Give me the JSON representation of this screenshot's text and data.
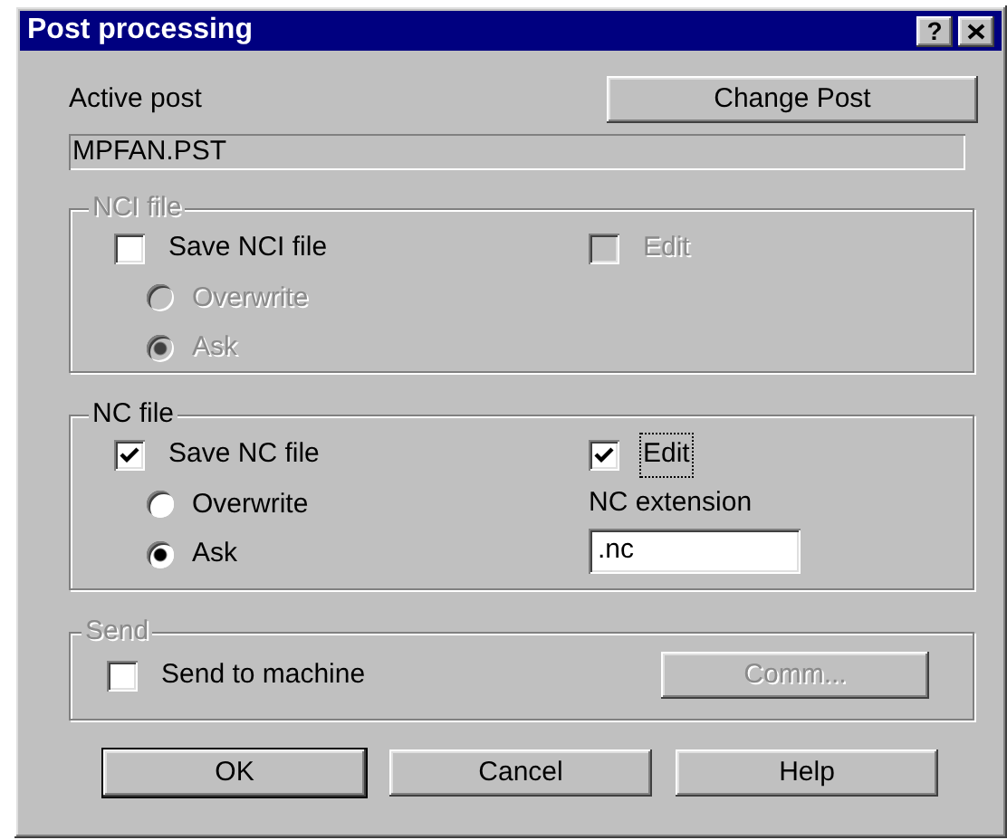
{
  "window": {
    "title": "Post processing",
    "help_button": "?"
  },
  "active_post": {
    "label": "Active post",
    "value": "MPFAN.PST"
  },
  "change_post_button": {
    "label": "Change Post",
    "disabled": false
  },
  "nci_file": {
    "title": "NCI file",
    "disabled": true,
    "save": {
      "label": "Save NCI file",
      "checked": false,
      "disabled": false,
      "focused": false
    },
    "edit": {
      "label": "Edit",
      "checked": false,
      "disabled": true,
      "focused": false
    },
    "options": [
      {
        "label": "Overwrite",
        "selected": false,
        "disabled": true
      },
      {
        "label": "Ask",
        "selected": true,
        "disabled": true
      }
    ]
  },
  "nc_file": {
    "title": "NC file",
    "disabled": false,
    "save": {
      "label": "Save NC file",
      "checked": true,
      "disabled": false,
      "focused": false
    },
    "edit": {
      "label": "Edit",
      "checked": true,
      "disabled": false,
      "focused": true
    },
    "options": [
      {
        "label": "Overwrite",
        "selected": false,
        "disabled": false
      },
      {
        "label": "Ask",
        "selected": true,
        "disabled": false
      }
    ],
    "extension": {
      "label": "NC extension",
      "value": ".nc"
    }
  },
  "send": {
    "title": "Send",
    "disabled": true,
    "send_to_machine": {
      "label": "Send to machine",
      "checked": false,
      "disabled": false,
      "focused": false
    },
    "comm_button": {
      "label": "Comm...",
      "disabled": true
    }
  },
  "buttons": [
    {
      "label": "OK",
      "default": true,
      "disabled": false
    },
    {
      "label": "Cancel",
      "default": false,
      "disabled": false
    },
    {
      "label": "Help",
      "default": false,
      "disabled": false
    }
  ]
}
